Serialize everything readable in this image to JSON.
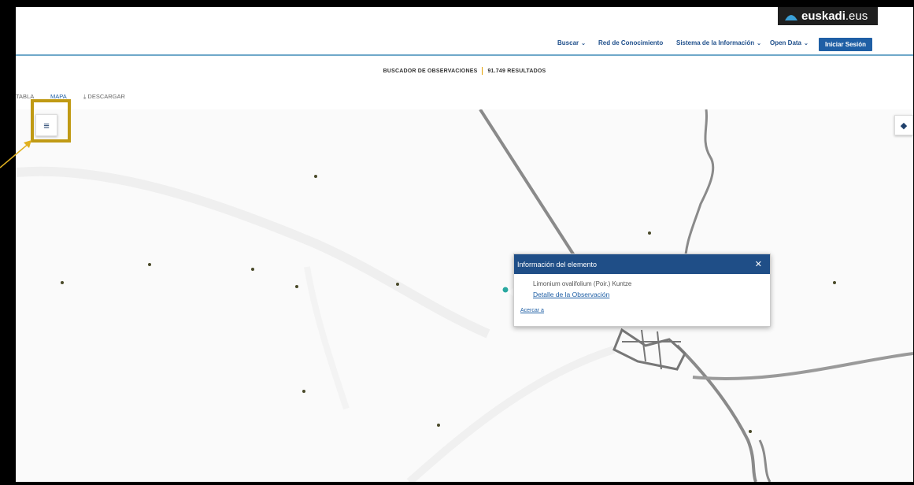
{
  "brand": {
    "name_bold": "euskadi",
    "name_suffix": ".eus"
  },
  "nav": {
    "items": [
      {
        "label": "Buscar",
        "has_dropdown": true
      },
      {
        "label": "Red de Conocimiento",
        "has_dropdown": false
      },
      {
        "label": "Sistema de la Información",
        "has_dropdown": true
      },
      {
        "label": "Open Data",
        "has_dropdown": true
      }
    ],
    "login_label": "Iniciar Sesión"
  },
  "subheader": {
    "title": "BUSCADOR DE OBSERVACIONES",
    "results": "91.749 RESULTADOS"
  },
  "tabs": [
    {
      "label": "TABLA"
    },
    {
      "label": "MAPA",
      "active": true
    },
    {
      "label": "DESCARGAR",
      "icon": "download-icon"
    }
  ],
  "popup": {
    "title": "Información del elemento",
    "close_icon": "close-icon",
    "species": "Limonium ovalifolium (Poir.) Kuntze",
    "detail_link": "Detalle de la Observación",
    "zoom_link": "Acercar a"
  },
  "icons": {
    "menu": "menu-icon",
    "layers": "layers-icon",
    "arrow": "annotation-arrow"
  },
  "colors": {
    "accent": "#1f5fa5",
    "header_bar": "#1f4e87",
    "highlight": "#c09a14",
    "brand_bg": "#1f1f1f"
  }
}
